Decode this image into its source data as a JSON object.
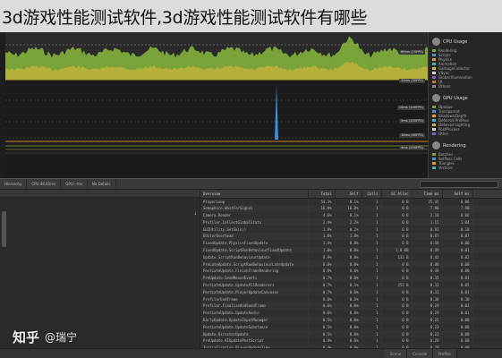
{
  "title": "3d游戏性能测试软件,3d游戏性能测试软件有哪些",
  "timeline": {
    "labels": [
      "66ms (15FPS)",
      "33ms (30FPS)",
      "10ms (100FPS)",
      "5ms (200FPS)",
      "16ms (60FPS)",
      "4ms (250FPS)"
    ]
  },
  "legend": {
    "cpu_title": "CPU Usage",
    "cpu_items": [
      "Rendering",
      "Scripts",
      "Physics",
      "Animation",
      "GarbageCollector",
      "VSync",
      "Global Illumination",
      "UI",
      "Others"
    ],
    "gpu_title": "GPU Usage",
    "gpu_items": [
      "Opaque",
      "Transparent",
      "Shadows/Depth",
      "Deferred PrePass",
      "Deferred Lighting",
      "PostProcess",
      "Other"
    ],
    "rendering_title": "Rendering",
    "rendering_items": [
      "Batches",
      "SetPass Calls",
      "Triangles",
      "Vertices"
    ],
    "colors": {
      "rendering": "#6fa83a",
      "scripts": "#4a8fcf",
      "physics": "#e0a030",
      "animation": "#3fb6b0",
      "gc": "#c7b64a",
      "vsync": "#d6d6d6",
      "gi": "#8a5ad0",
      "ui": "#c9772e",
      "others": "#888888"
    }
  },
  "toolbar": {
    "items": [
      "Hierarchy",
      "CPU:46.85ms",
      "GPU:--ms",
      "No Details"
    ],
    "search_placeholder": ""
  },
  "table": {
    "columns": [
      "Overview",
      "Total",
      "Self",
      "Calls",
      "GC Alloc",
      "Time ms",
      "Self ms",
      ""
    ],
    "rows": [
      [
        "PlayerLoop",
        "54.3%",
        "0.1%",
        "1",
        "0 B",
        "25.45",
        "0.06"
      ],
      [
        "Semaphore.WaitForSignal",
        "16.8%",
        "16.8%",
        "1",
        "0 B",
        "7.90",
        "7.90"
      ],
      [
        "Camera.Render",
        "4.6%",
        "0.1%",
        "1",
        "0 B",
        "2.18",
        "0.06"
      ],
      [
        "Profiler.CollectGlobalStats",
        "2.4%",
        "2.2%",
        "1",
        "0 B",
        "1.15",
        "1.04"
      ],
      [
        "GUIUtility.SetSkin()",
        "1.9%",
        "0.2%",
        "1",
        "0 B",
        "0.91",
        "0.10"
      ],
      [
        "EditorOverhead",
        "1.8%",
        "1.8%",
        "1",
        "0 B",
        "0.87",
        "0.87"
      ],
      [
        "FixedUpdate.PhysicsFixedUpdate",
        "1.4%",
        "0.0%",
        "1",
        "0 B",
        "0.68",
        "0.00"
      ],
      [
        "FixedUpdate.ScriptRunBehaviourFixedUpdate",
        "1.0%",
        "0.0%",
        "1",
        "1.8 KB",
        "0.49",
        "0.01"
      ],
      [
        "Update.ScriptRunBehaviourUpdate",
        "0.9%",
        "0.0%",
        "1",
        "132 B",
        "0.42",
        "0.02"
      ],
      [
        "PreLateUpdate.ScriptRunBehaviourLateUpdate",
        "0.8%",
        "0.0%",
        "1",
        "0 B",
        "0.40",
        "0.00"
      ],
      [
        "PostLateUpdate.FinishFrameRendering",
        "0.8%",
        "0.0%",
        "1",
        "0 B",
        "0.38",
        "0.00"
      ],
      [
        "PreUpdate.SendMouseEvents",
        "0.7%",
        "0.0%",
        "1",
        "0 B",
        "0.35",
        "0.01"
      ],
      [
        "PostLateUpdate.UpdateAllRenderers",
        "0.7%",
        "0.1%",
        "1",
        "252 B",
        "0.33",
        "0.05"
      ],
      [
        "PostLateUpdate.PlayerUpdateCanvases",
        "0.7%",
        "0.0%",
        "1",
        "0 B",
        "0.33",
        "0.01"
      ],
      [
        "ProfilerEndFrame",
        "0.6%",
        "0.6%",
        "1",
        "0 B",
        "0.30",
        "0.30"
      ],
      [
        "Profiler.FinalizeAndSendFrame",
        "0.6%",
        "0.0%",
        "1",
        "0 B",
        "0.29",
        "0.02"
      ],
      [
        "PostLateUpdate.UpdateAudio",
        "0.6%",
        "0.0%",
        "1",
        "0 B",
        "0.29",
        "0.01"
      ],
      [
        "EarlyUpdate.UpdateInputManager",
        "0.5%",
        "0.0%",
        "1",
        "0 B",
        "0.25",
        "0.00"
      ],
      [
        "PostLateUpdate.UpdateSubstance",
        "0.5%",
        "0.0%",
        "1",
        "0 B",
        "0.23",
        "0.00"
      ],
      [
        "Update.DirectorUpdate",
        "0.5%",
        "0.0%",
        "1",
        "0 B",
        "0.22",
        "0.00"
      ],
      [
        "PreUpdate.AIUpdatePostScript",
        "0.4%",
        "0.0%",
        "1",
        "0 B",
        "0.20",
        "0.00"
      ],
      [
        "Initialization.PlayerUpdateTime",
        "0.4%",
        "0.0%",
        "1",
        "0 B",
        "0.20",
        "0.00"
      ]
    ]
  },
  "status": {
    "tabs": [
      "Scene",
      "Console",
      "Profiler"
    ]
  },
  "watermark": {
    "logo": "知乎",
    "handle": "@瑞宁"
  }
}
